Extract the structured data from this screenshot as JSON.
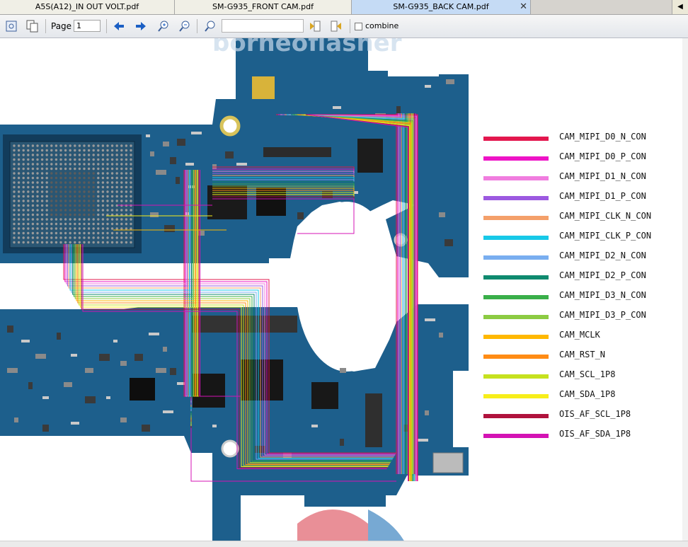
{
  "tabs": [
    {
      "label": "A5S(A12)_IN OUT VOLT.pdf"
    },
    {
      "label": "SM-G935_FRONT CAM.pdf"
    },
    {
      "label": "SM-G935_BACK CAM.pdf"
    }
  ],
  "tab_close": "✕",
  "tab_scroll": "◀",
  "toolbar": {
    "page_label": "Page",
    "page_value": "1",
    "search_value": "",
    "combine_label": "combine"
  },
  "watermark": "borneoflasher",
  "legend": [
    {
      "label": "CAM_MIPI_D0_N_CON",
      "color": "#e3174e"
    },
    {
      "label": "CAM_MIPI_D0_P_CON",
      "color": "#ee13c6"
    },
    {
      "label": "CAM_MIPI_D1_N_CON",
      "color": "#f07ddf"
    },
    {
      "label": "CAM_MIPI_D1_P_CON",
      "color": "#9c59e0"
    },
    {
      "label": "CAM_MIPI_CLK_N_CON",
      "color": "#f4a06a"
    },
    {
      "label": "CAM_MIPI_CLK_P_CON",
      "color": "#17c9e8"
    },
    {
      "label": "CAM_MIPI_D2_N_CON",
      "color": "#79aef0"
    },
    {
      "label": "CAM_MIPI_D2_P_CON",
      "color": "#0f8a6f"
    },
    {
      "label": "CAM_MIPI_D3_N_CON",
      "color": "#3aaf4a"
    },
    {
      "label": "CAM_MIPI_D3_P_CON",
      "color": "#8ccb43"
    },
    {
      "label": "CAM_MCLK",
      "color": "#ffb800"
    },
    {
      "label": "CAM_RST_N",
      "color": "#ff8c14"
    },
    {
      "label": "CAM_SCL_1P8",
      "color": "#c6e11f"
    },
    {
      "label": "CAM_SDA_1P8",
      "color": "#f7ee1a"
    },
    {
      "label": "OIS_AF_SCL_1P8",
      "color": "#b0123d"
    },
    {
      "label": "OIS_AF_SDA_1P8",
      "color": "#d413b4"
    }
  ],
  "colors": {
    "board": "#1d5f8c",
    "board_dark": "#154a6e",
    "accent_tab": "#c5dbf5"
  }
}
